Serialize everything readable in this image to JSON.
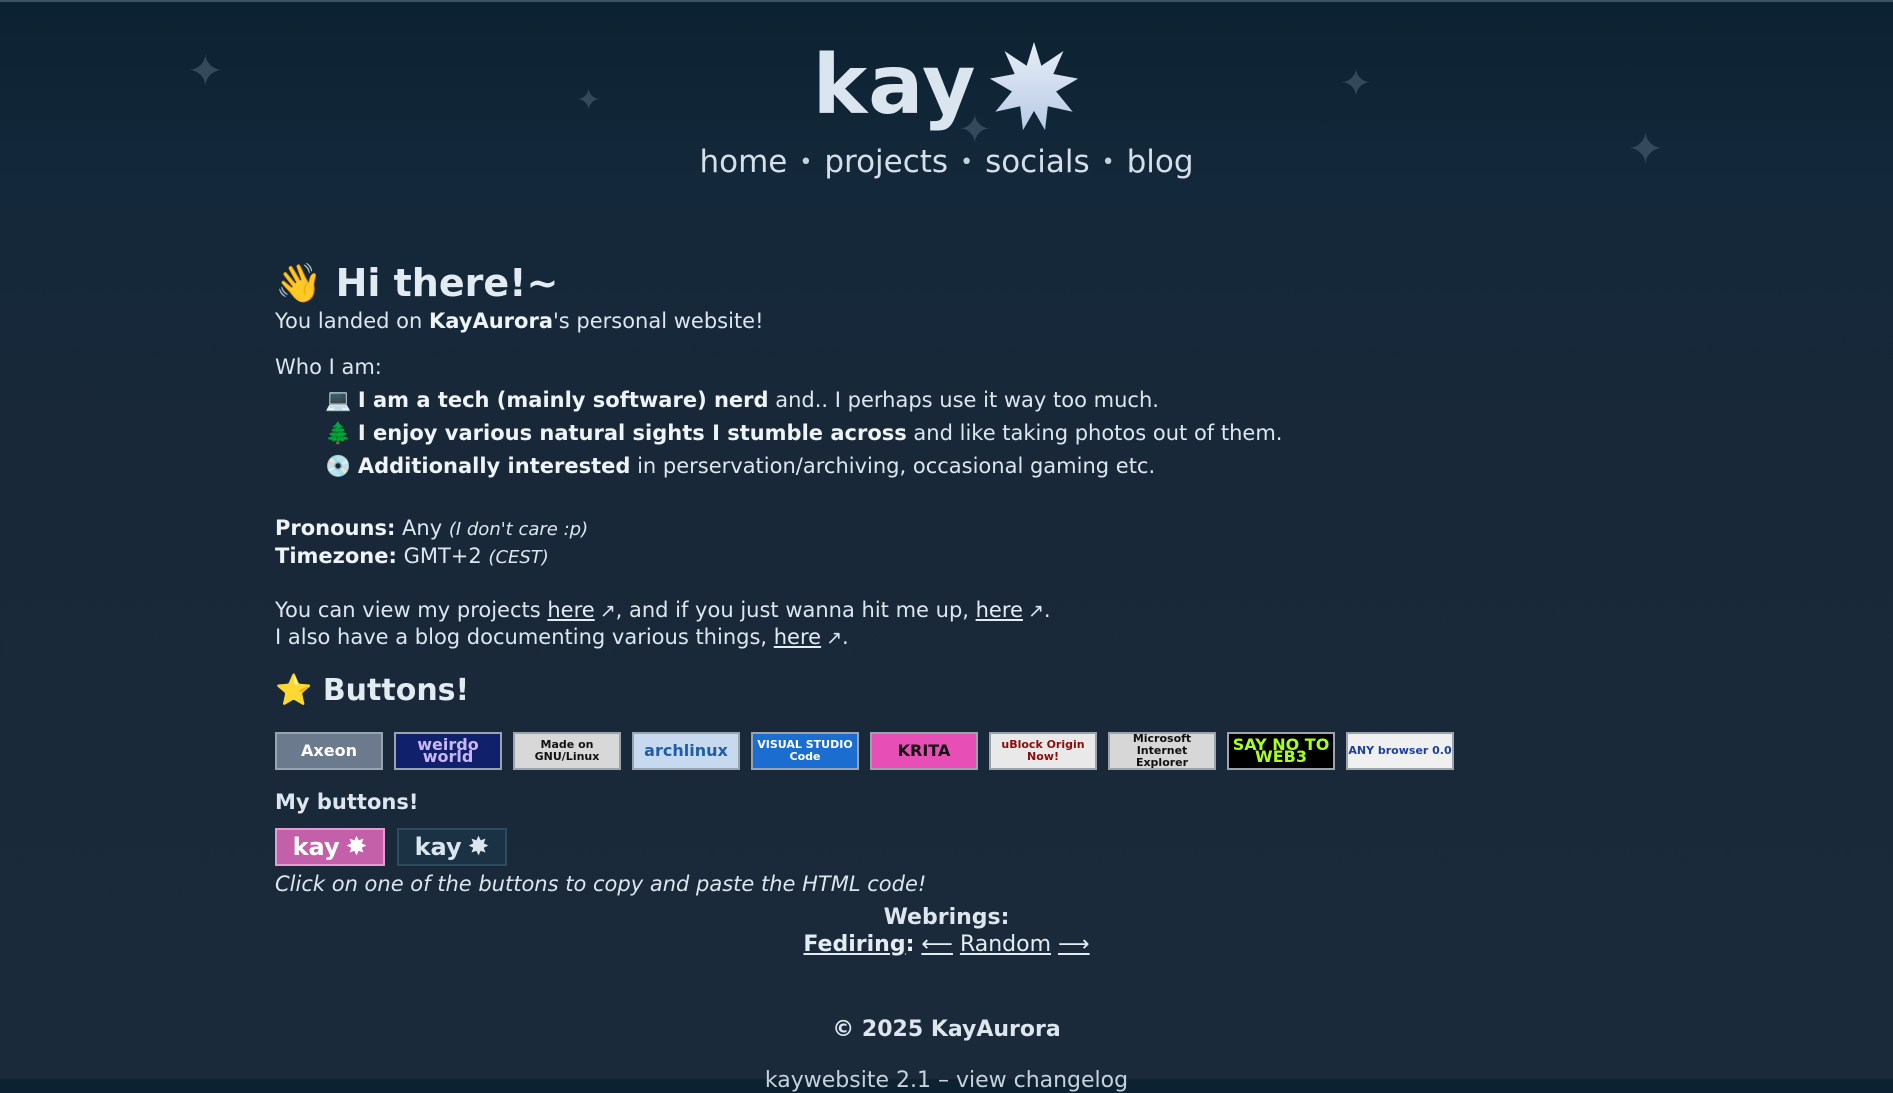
{
  "site": {
    "logo_text": "kay",
    "nav": [
      "home",
      "projects",
      "socials",
      "blog"
    ]
  },
  "intro": {
    "heading_emoji": "👋",
    "heading": "Hi there!~",
    "landed_prefix": "You landed on ",
    "landed_name": "KayAurora",
    "landed_suffix": "'s personal website!",
    "who_label": "Who I am:",
    "items": [
      {
        "emoji": "💻",
        "bold": "I am a tech (mainly software) nerd",
        "rest": " and.. I perhaps use it way too much."
      },
      {
        "emoji": "🌲",
        "bold": "I enjoy various natural sights I stumble across",
        "rest": " and like taking photos out of them."
      },
      {
        "emoji": "💿",
        "bold": "Additionally interested",
        "rest": " in perservation/archiving, occasional gaming etc."
      }
    ],
    "pronouns_label": "Pronouns:",
    "pronouns_value": " Any ",
    "pronouns_note": "(I don't care :p)",
    "timezone_label": "Timezone:",
    "timezone_value": " GMT+2 ",
    "timezone_note": "(CEST)",
    "projects_prefix": "You can view my projects ",
    "here": "here",
    "projects_mid": ", and if you just wanna hit me up, ",
    "blog_prefix": "I also have a blog documenting various things, ",
    "period": ".",
    "ext_icon": "↗"
  },
  "buttons_section": {
    "emoji": "⭐",
    "heading": "Buttons!",
    "badges": [
      {
        "name": "axeon-button",
        "text": "Axeon",
        "bg": "#6b7a8c",
        "fg": "#ffffff"
      },
      {
        "name": "weirdo-world-button",
        "text": "weirdo world",
        "bg": "#10206a",
        "fg": "#c9b8ff"
      },
      {
        "name": "made-on-gnu-linux-button",
        "text": "Made on GNU/Linux",
        "bg": "#d8d8d8",
        "fg": "#111111"
      },
      {
        "name": "archlinux-button",
        "text": "archlinux",
        "bg": "#c7d9ee",
        "fg": "#1f5da8"
      },
      {
        "name": "visual-studio-code-button",
        "text": "VISUAL STUDIO Code",
        "bg": "#1b6ed0",
        "fg": "#ffffff"
      },
      {
        "name": "krita-button",
        "text": "KRITA",
        "bg": "#e84fb6",
        "fg": "#111111"
      },
      {
        "name": "ublock-origin-button",
        "text": "uBlock Origin Now!",
        "bg": "#e9e9e9",
        "fg": "#8a0c0c"
      },
      {
        "name": "internet-explorer-button",
        "text": "Microsoft Internet Explorer",
        "bg": "#d7d7d7",
        "fg": "#111111"
      },
      {
        "name": "say-no-to-web3-button",
        "text": "SAY NO TO WEB3",
        "bg": "#000000",
        "fg": "#a7ff24"
      },
      {
        "name": "any-browser-button",
        "text": "ANY browser 0.0",
        "bg": "#f0f0f0",
        "fg": "#1a3fa0"
      }
    ],
    "my_buttons_label": "My buttons!",
    "my_buttons": [
      {
        "name": "kay-pink-button",
        "text": "kay",
        "bg": "#c45fa9",
        "fg": "#ffffff"
      },
      {
        "name": "kay-dark-button",
        "text": "kay",
        "bg": "#1a3244",
        "fg": "#dbe5f0"
      }
    ],
    "copy_hint": "Click on one of the buttons to copy and paste the HTML code!"
  },
  "webrings": {
    "label": "Webrings:",
    "ring_name": "Fediring",
    "colon": ":",
    "prev": "⟵",
    "random": "Random",
    "next": "⟶"
  },
  "footer": {
    "copyright": "© 2025 KayAurora",
    "version_text": "kaywebsite 2.1 – view changelog"
  }
}
